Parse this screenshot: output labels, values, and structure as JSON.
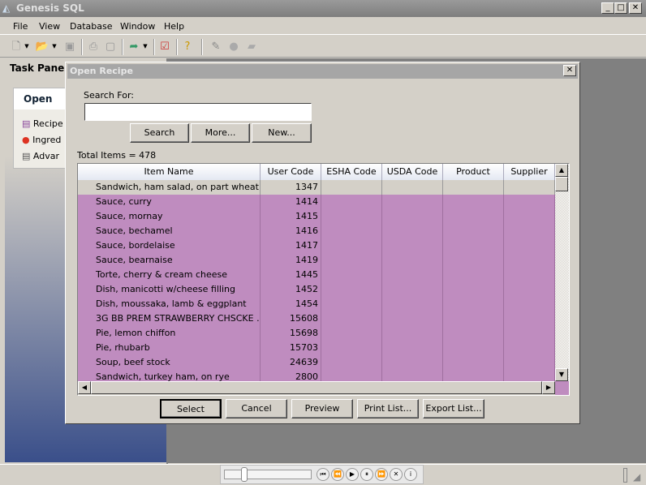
{
  "app": {
    "title": "Genesis SQL",
    "accent": "#bf8cbf"
  },
  "menu": [
    "File",
    "View",
    "Database",
    "Window",
    "Help"
  ],
  "toolbar": {
    "icons": [
      "new-icon",
      "dropdown-icon",
      "open-icon",
      "dropdown-icon",
      "save-icon",
      "print-icon",
      "print-preview-icon",
      "export-icon",
      "dropdown-icon",
      "report-icon",
      "help-icon",
      "edit-icon",
      "comment-icon",
      "folder-icon"
    ]
  },
  "task_panel": {
    "title": "Task Panel",
    "section": "Open",
    "items": [
      "Recipe",
      "Ingred",
      "Advar"
    ]
  },
  "dialog": {
    "title": "Open Recipe",
    "search_label": "Search For:",
    "search_value": "",
    "search_button": "Search",
    "more_button": "More...",
    "new_button": "New...",
    "total": "Total Items = 478",
    "columns": [
      "Item Name",
      "User Code",
      "ESHA Code",
      "USDA Code",
      "Product",
      "Supplier"
    ],
    "rows": [
      [
        "Sandwich, ham salad, on part wheat",
        "1347"
      ],
      [
        "Sauce, curry",
        "1414"
      ],
      [
        "Sauce, mornay",
        "1415"
      ],
      [
        "Sauce, bechamel",
        "1416"
      ],
      [
        "Sauce, bordelaise",
        "1417"
      ],
      [
        "Sauce, bearnaise",
        "1419"
      ],
      [
        "Torte, cherry & cream cheese",
        "1445"
      ],
      [
        "Dish, manicotti w/cheese filling",
        "1452"
      ],
      [
        "Dish, moussaka, lamb & eggplant",
        "1454"
      ],
      [
        "3G  BB PREM STRAWBERRY CHSCKE  ...",
        "15608"
      ],
      [
        "Pie, lemon chiffon",
        "15698"
      ],
      [
        "Pie, rhubarb",
        "15703"
      ],
      [
        "Soup, beef stock",
        "24639"
      ],
      [
        "Sandwich, turkey ham, on rye",
        "2800"
      ]
    ],
    "buttons": [
      "Select",
      "Cancel",
      "Preview",
      "Print List...",
      "Export List..."
    ]
  },
  "media": {
    "position": 0.2
  }
}
